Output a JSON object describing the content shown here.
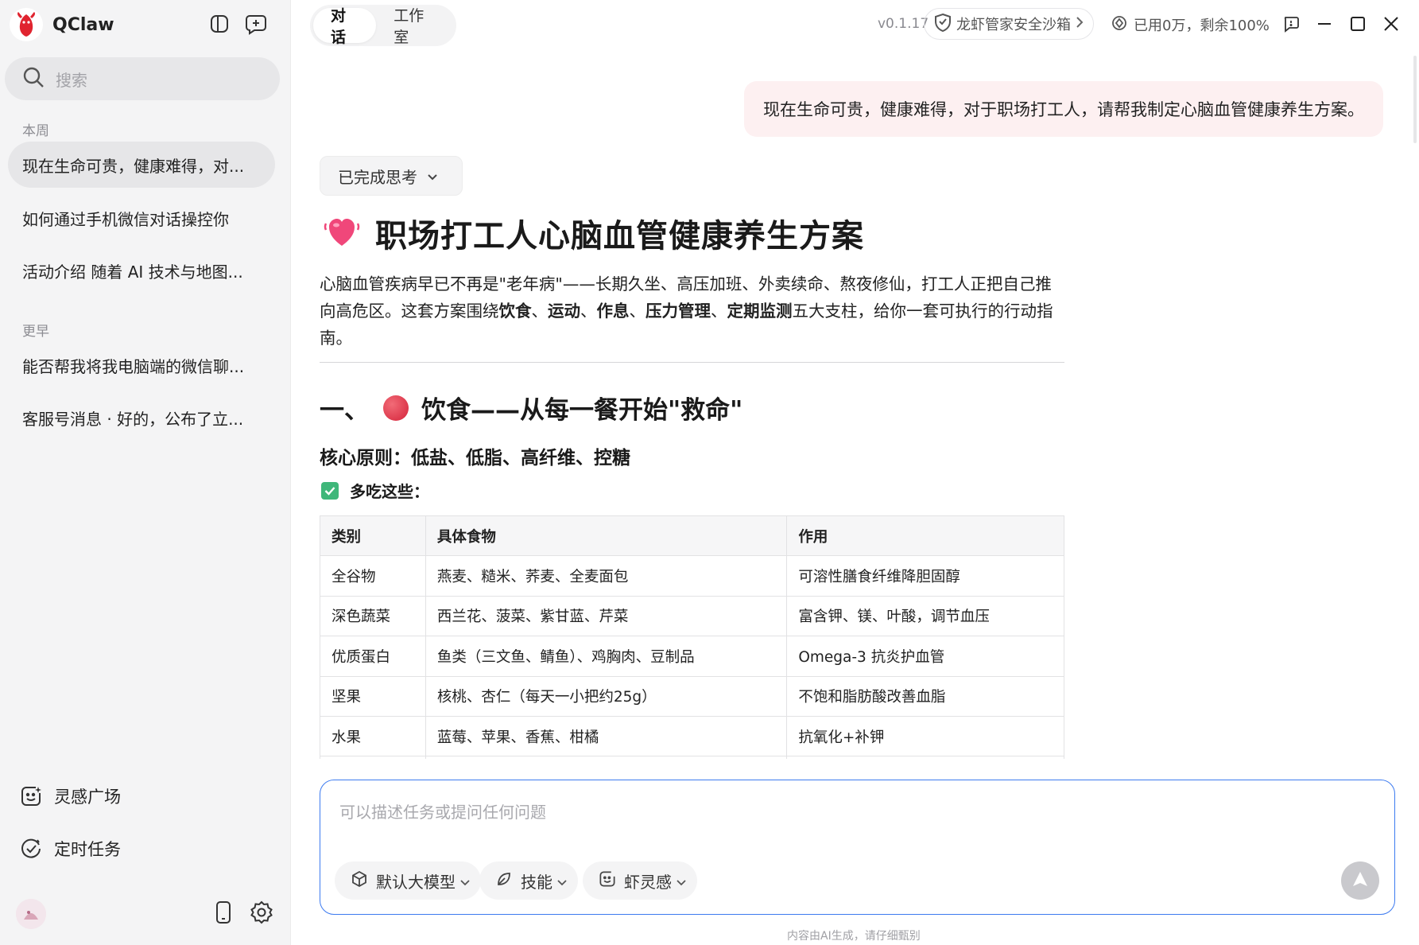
{
  "app": {
    "name": "QClaw"
  },
  "sidebar": {
    "search_placeholder": "搜索",
    "section_this_week": "本周",
    "section_earlier": "更早",
    "this_week": [
      {
        "label": "现在生命可贵，健康难得，对..."
      },
      {
        "label": "如何通过手机微信对话操控你"
      },
      {
        "label": "活动介绍 随着 AI 技术与地图..."
      }
    ],
    "earlier": [
      {
        "label": "能否帮我将我电脑端的微信聊..."
      },
      {
        "label": "客服号消息 · 好的，公布了立..."
      }
    ],
    "nav": [
      {
        "label": "灵感广场",
        "icon": "smile-sparkle-icon"
      },
      {
        "label": "定时任务",
        "icon": "clock-check-icon"
      }
    ]
  },
  "header": {
    "tabs": [
      {
        "label": "对话"
      },
      {
        "label": "工作室"
      }
    ],
    "version": "v0.1.17",
    "sandbox": "龙虾管家安全沙箱",
    "usage": "已用0万，剩余100%"
  },
  "chat": {
    "user_message": "现在生命可贵，健康难得，对于职场打工人，请帮我制定心脑血管健康养生方案。",
    "thinking_label": "已完成思考",
    "title": "职场打工人心脑血管健康养生方案",
    "intro": {
      "p1": "心脑血管疾病早已不再是\"老年病\"——长期久坐、高压加班、外卖续命、熬夜修仙，打工人正把自己推向高危区。这套方案围绕",
      "b1": "饮食",
      "s1": "、",
      "b2": "运动",
      "s2": "、",
      "b3": "作息",
      "s3": "、",
      "b4": "压力管理",
      "s4": "、",
      "b5": "定期监测",
      "p2": "五大支柱，给你一套可执行的行动指南。"
    },
    "section1": {
      "prefix": "一、",
      "title": "饮食——从每一餐开始\"救命\"",
      "principle": "核心原则：低盐、低脂、高纤维、控糖",
      "eat_more": "多吃这些："
    },
    "table": {
      "headers": [
        "类别",
        "具体食物",
        "作用"
      ],
      "rows": [
        [
          "全谷物",
          "燕麦、糙米、荞麦、全麦面包",
          "可溶性膳食纤维降胆固醇"
        ],
        [
          "深色蔬菜",
          "西兰花、菠菜、紫甘蓝、芹菜",
          "富含钾、镁、叶酸，调节血压"
        ],
        [
          "优质蛋白",
          "鱼类（三文鱼、鲭鱼）、鸡胸肉、豆制品",
          "Omega-3 抗炎护血管"
        ],
        [
          "坚果",
          "核桃、杏仁（每天一小把约25g）",
          "不饱和脂肪酸改善血脂"
        ],
        [
          "水果",
          "蓝莓、苹果、香蕉、柑橘",
          "抗氧化+补钾"
        ]
      ]
    }
  },
  "composer": {
    "placeholder": "可以描述任务或提问任何问题",
    "model": "默认大模型",
    "skills": "技能",
    "inspiration": "虾灵感",
    "disclaimer": "内容由AI生成，请仔细甄别"
  },
  "colors": {
    "accent": "#3d7bf0",
    "user_bubble": "#fdf0f1",
    "sidebar_bg": "#f4f4f5"
  }
}
